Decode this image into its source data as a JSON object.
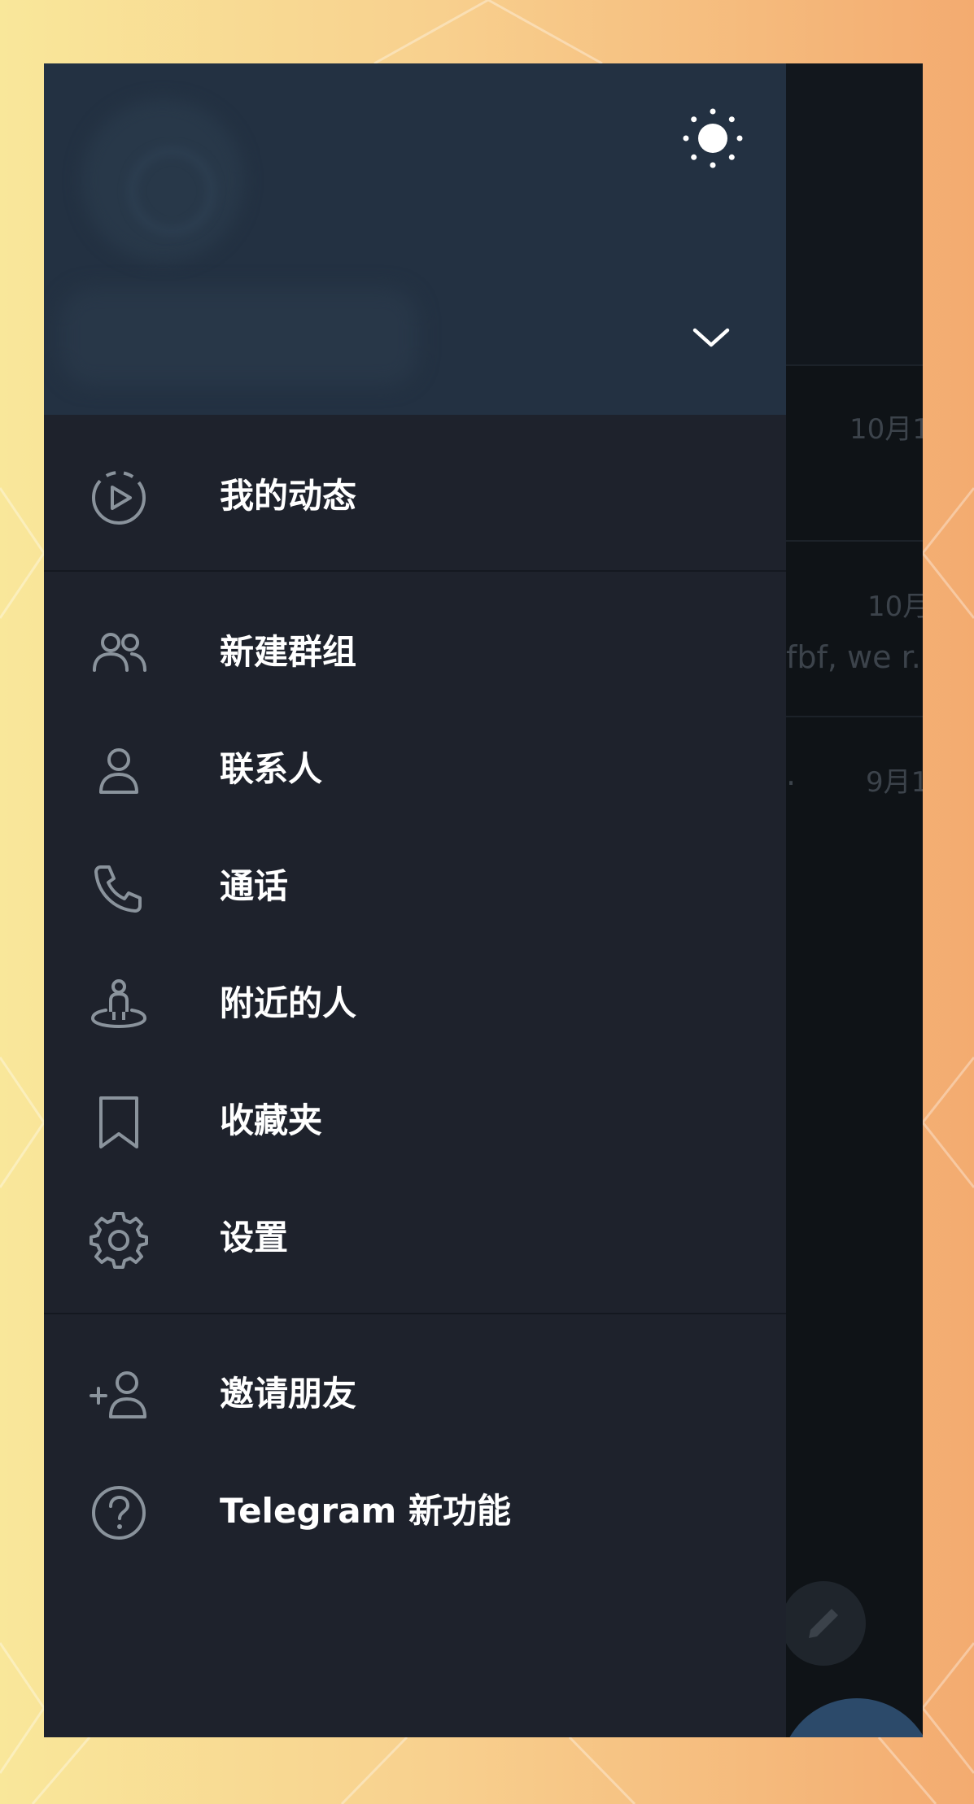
{
  "drawer": {
    "header": {
      "theme_icon": "sun-icon",
      "expand_icon": "chevron-down-icon"
    },
    "menu": {
      "my_stories": {
        "label": "我的动态",
        "icon": "story-play-icon"
      },
      "new_group": {
        "label": "新建群组",
        "icon": "group-icon"
      },
      "contacts": {
        "label": "联系人",
        "icon": "person-icon"
      },
      "calls": {
        "label": "通话",
        "icon": "phone-icon"
      },
      "nearby": {
        "label": "附近的人",
        "icon": "nearby-person-icon"
      },
      "saved": {
        "label": "收藏夹",
        "icon": "bookmark-icon"
      },
      "settings": {
        "label": "设置",
        "icon": "gear-icon"
      },
      "invite": {
        "label": "邀请朋友",
        "icon": "add-person-icon"
      },
      "features": {
        "label": "Telegram 新功能",
        "icon": "question-icon"
      }
    }
  },
  "background_chats": {
    "row1_date": "10月1",
    "row2_date": "10月",
    "row2_preview": "fbf, we r.",
    "row3_preview": ".",
    "row3_date": "9月1"
  },
  "colors": {
    "drawer_bg": "#1e222c",
    "header_bg": "#233142",
    "icon_stroke": "#8a939c",
    "label_text": "#ffffff"
  }
}
